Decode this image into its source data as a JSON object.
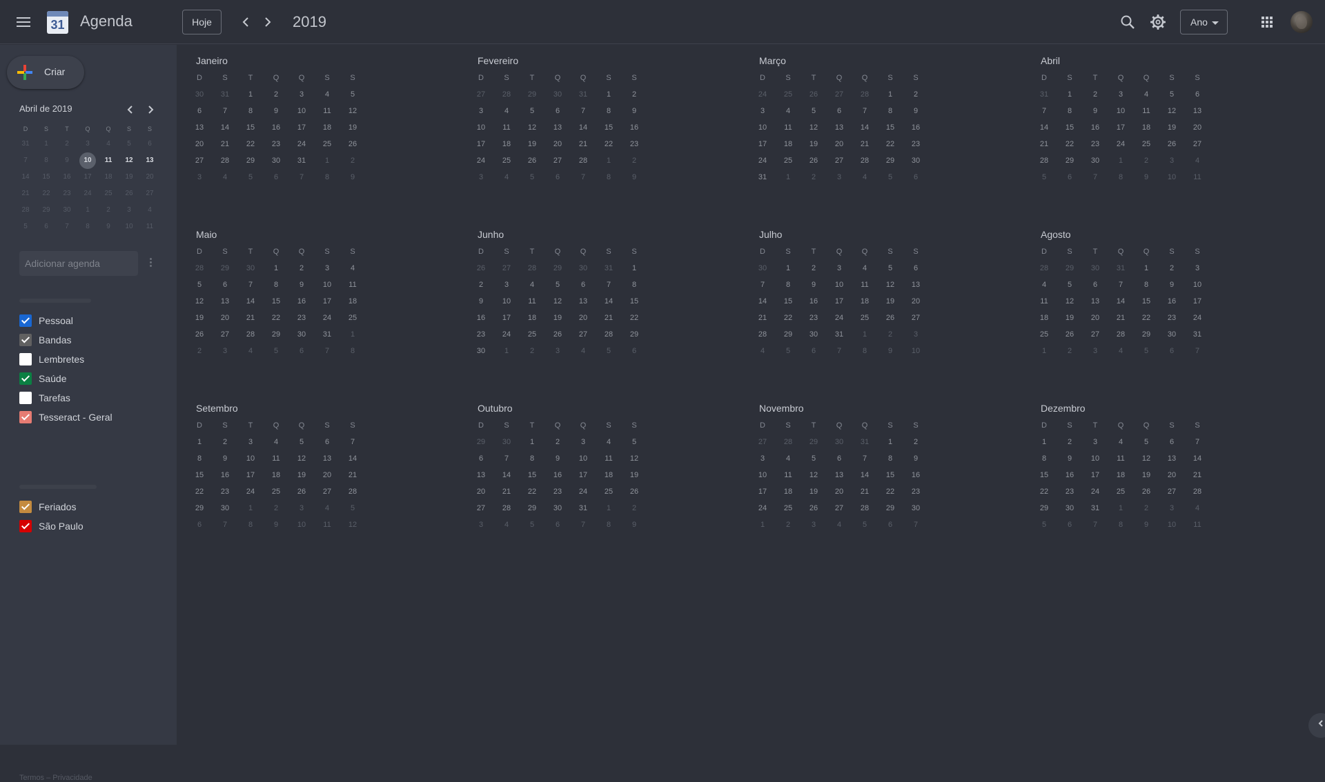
{
  "header": {
    "app_icon_number": "31",
    "app_title": "Agenda",
    "today_label": "Hoje",
    "prev_icon": "chevron-left-icon",
    "next_icon": "chevron-right-icon",
    "year": "2019",
    "search_icon": "search-icon",
    "settings_icon": "gear-icon",
    "view_label": "Ano",
    "apps_icon": "apps-grid-icon"
  },
  "sidebar": {
    "create_label": "Criar",
    "mini_calendar": {
      "title": "Abril de 2019",
      "weekdays": [
        "D",
        "S",
        "T",
        "Q",
        "Q",
        "S",
        "S"
      ],
      "weeks": [
        [
          "31",
          "1",
          "2",
          "3",
          "4",
          "5",
          "6"
        ],
        [
          "7",
          "8",
          "9",
          "10",
          "11",
          "12",
          "13"
        ],
        [
          "14",
          "15",
          "16",
          "17",
          "18",
          "19",
          "20"
        ],
        [
          "21",
          "22",
          "23",
          "24",
          "25",
          "26",
          "27"
        ],
        [
          "28",
          "29",
          "30",
          "1",
          "2",
          "3",
          "4"
        ],
        [
          "5",
          "6",
          "7",
          "8",
          "9",
          "10",
          "11"
        ]
      ],
      "today": "10"
    },
    "add_calendar_placeholder": "Adicionar agenda",
    "my_calendars": [
      {
        "label": "Pessoal",
        "checked": true,
        "color": "#1967d2"
      },
      {
        "label": "Bandas",
        "checked": true,
        "color": "#616161"
      },
      {
        "label": "Lembretes",
        "checked": false,
        "color": "#ffffff"
      },
      {
        "label": "Saúde",
        "checked": true,
        "color": "#0b8043"
      },
      {
        "label": "Tarefas",
        "checked": false,
        "color": "#ffffff"
      },
      {
        "label": "Tesseract - Geral",
        "checked": true,
        "color": "#e67c73"
      }
    ],
    "other_calendars": [
      {
        "label": "Feriados",
        "checked": true,
        "color": "#c48b3f"
      },
      {
        "label": "São Paulo",
        "checked": true,
        "color": "#d50000"
      }
    ],
    "footer": "Termos – Privacidade"
  },
  "year_view": {
    "weekdays": [
      "D",
      "S",
      "T",
      "Q",
      "Q",
      "S",
      "S"
    ],
    "months": [
      {
        "name": "Janeiro",
        "weeks": [
          [
            "30",
            "31",
            "1",
            "2",
            "3",
            "4",
            "5"
          ],
          [
            "6",
            "7",
            "8",
            "9",
            "10",
            "11",
            "12"
          ],
          [
            "13",
            "14",
            "15",
            "16",
            "17",
            "18",
            "19"
          ],
          [
            "20",
            "21",
            "22",
            "23",
            "24",
            "25",
            "26"
          ],
          [
            "27",
            "28",
            "29",
            "30",
            "31",
            "1",
            "2"
          ],
          [
            "3",
            "4",
            "5",
            "6",
            "7",
            "8",
            "9"
          ]
        ]
      },
      {
        "name": "Fevereiro",
        "weeks": [
          [
            "27",
            "28",
            "29",
            "30",
            "31",
            "1",
            "2"
          ],
          [
            "3",
            "4",
            "5",
            "6",
            "7",
            "8",
            "9"
          ],
          [
            "10",
            "11",
            "12",
            "13",
            "14",
            "15",
            "16"
          ],
          [
            "17",
            "18",
            "19",
            "20",
            "21",
            "22",
            "23"
          ],
          [
            "24",
            "25",
            "26",
            "27",
            "28",
            "1",
            "2"
          ],
          [
            "3",
            "4",
            "5",
            "6",
            "7",
            "8",
            "9"
          ]
        ]
      },
      {
        "name": "Março",
        "weeks": [
          [
            "24",
            "25",
            "26",
            "27",
            "28",
            "1",
            "2"
          ],
          [
            "3",
            "4",
            "5",
            "6",
            "7",
            "8",
            "9"
          ],
          [
            "10",
            "11",
            "12",
            "13",
            "14",
            "15",
            "16"
          ],
          [
            "17",
            "18",
            "19",
            "20",
            "21",
            "22",
            "23"
          ],
          [
            "24",
            "25",
            "26",
            "27",
            "28",
            "29",
            "30"
          ],
          [
            "31",
            "1",
            "2",
            "3",
            "4",
            "5",
            "6"
          ]
        ]
      },
      {
        "name": "Abril",
        "weeks": [
          [
            "31",
            "1",
            "2",
            "3",
            "4",
            "5",
            "6"
          ],
          [
            "7",
            "8",
            "9",
            "10",
            "11",
            "12",
            "13"
          ],
          [
            "14",
            "15",
            "16",
            "17",
            "18",
            "19",
            "20"
          ],
          [
            "21",
            "22",
            "23",
            "24",
            "25",
            "26",
            "27"
          ],
          [
            "28",
            "29",
            "30",
            "1",
            "2",
            "3",
            "4"
          ],
          [
            "5",
            "6",
            "7",
            "8",
            "9",
            "10",
            "11"
          ]
        ]
      },
      {
        "name": "Maio",
        "weeks": [
          [
            "28",
            "29",
            "30",
            "1",
            "2",
            "3",
            "4"
          ],
          [
            "5",
            "6",
            "7",
            "8",
            "9",
            "10",
            "11"
          ],
          [
            "12",
            "13",
            "14",
            "15",
            "16",
            "17",
            "18"
          ],
          [
            "19",
            "20",
            "21",
            "22",
            "23",
            "24",
            "25"
          ],
          [
            "26",
            "27",
            "28",
            "29",
            "30",
            "31",
            "1"
          ],
          [
            "2",
            "3",
            "4",
            "5",
            "6",
            "7",
            "8"
          ]
        ]
      },
      {
        "name": "Junho",
        "weeks": [
          [
            "26",
            "27",
            "28",
            "29",
            "30",
            "31",
            "1"
          ],
          [
            "2",
            "3",
            "4",
            "5",
            "6",
            "7",
            "8"
          ],
          [
            "9",
            "10",
            "11",
            "12",
            "13",
            "14",
            "15"
          ],
          [
            "16",
            "17",
            "18",
            "19",
            "20",
            "21",
            "22"
          ],
          [
            "23",
            "24",
            "25",
            "26",
            "27",
            "28",
            "29"
          ],
          [
            "30",
            "1",
            "2",
            "3",
            "4",
            "5",
            "6"
          ]
        ]
      },
      {
        "name": "Julho",
        "weeks": [
          [
            "30",
            "1",
            "2",
            "3",
            "4",
            "5",
            "6"
          ],
          [
            "7",
            "8",
            "9",
            "10",
            "11",
            "12",
            "13"
          ],
          [
            "14",
            "15",
            "16",
            "17",
            "18",
            "19",
            "20"
          ],
          [
            "21",
            "22",
            "23",
            "24",
            "25",
            "26",
            "27"
          ],
          [
            "28",
            "29",
            "30",
            "31",
            "1",
            "2",
            "3"
          ],
          [
            "4",
            "5",
            "6",
            "7",
            "8",
            "9",
            "10"
          ]
        ]
      },
      {
        "name": "Agosto",
        "weeks": [
          [
            "28",
            "29",
            "30",
            "31",
            "1",
            "2",
            "3"
          ],
          [
            "4",
            "5",
            "6",
            "7",
            "8",
            "9",
            "10"
          ],
          [
            "11",
            "12",
            "13",
            "14",
            "15",
            "16",
            "17"
          ],
          [
            "18",
            "19",
            "20",
            "21",
            "22",
            "23",
            "24"
          ],
          [
            "25",
            "26",
            "27",
            "28",
            "29",
            "30",
            "31"
          ],
          [
            "1",
            "2",
            "3",
            "4",
            "5",
            "6",
            "7"
          ]
        ]
      },
      {
        "name": "Setembro",
        "weeks": [
          [
            "1",
            "2",
            "3",
            "4",
            "5",
            "6",
            "7"
          ],
          [
            "8",
            "9",
            "10",
            "11",
            "12",
            "13",
            "14"
          ],
          [
            "15",
            "16",
            "17",
            "18",
            "19",
            "20",
            "21"
          ],
          [
            "22",
            "23",
            "24",
            "25",
            "26",
            "27",
            "28"
          ],
          [
            "29",
            "30",
            "1",
            "2",
            "3",
            "4",
            "5"
          ],
          [
            "6",
            "7",
            "8",
            "9",
            "10",
            "11",
            "12"
          ]
        ]
      },
      {
        "name": "Outubro",
        "weeks": [
          [
            "29",
            "30",
            "1",
            "2",
            "3",
            "4",
            "5"
          ],
          [
            "6",
            "7",
            "8",
            "9",
            "10",
            "11",
            "12"
          ],
          [
            "13",
            "14",
            "15",
            "16",
            "17",
            "18",
            "19"
          ],
          [
            "20",
            "21",
            "22",
            "23",
            "24",
            "25",
            "26"
          ],
          [
            "27",
            "28",
            "29",
            "30",
            "31",
            "1",
            "2"
          ],
          [
            "3",
            "4",
            "5",
            "6",
            "7",
            "8",
            "9"
          ]
        ]
      },
      {
        "name": "Novembro",
        "weeks": [
          [
            "27",
            "28",
            "29",
            "30",
            "31",
            "1",
            "2"
          ],
          [
            "3",
            "4",
            "5",
            "6",
            "7",
            "8",
            "9"
          ],
          [
            "10",
            "11",
            "12",
            "13",
            "14",
            "15",
            "16"
          ],
          [
            "17",
            "18",
            "19",
            "20",
            "21",
            "22",
            "23"
          ],
          [
            "24",
            "25",
            "26",
            "27",
            "28",
            "29",
            "30"
          ],
          [
            "1",
            "2",
            "3",
            "4",
            "5",
            "6",
            "7"
          ]
        ]
      },
      {
        "name": "Dezembro",
        "weeks": [
          [
            "1",
            "2",
            "3",
            "4",
            "5",
            "6",
            "7"
          ],
          [
            "8",
            "9",
            "10",
            "11",
            "12",
            "13",
            "14"
          ],
          [
            "15",
            "16",
            "17",
            "18",
            "19",
            "20",
            "21"
          ],
          [
            "22",
            "23",
            "24",
            "25",
            "26",
            "27",
            "28"
          ],
          [
            "29",
            "30",
            "31",
            "1",
            "2",
            "3",
            "4"
          ],
          [
            "5",
            "6",
            "7",
            "8",
            "9",
            "10",
            "11"
          ]
        ]
      }
    ]
  },
  "side_panel_toggle_icon": "chevron-left-icon"
}
